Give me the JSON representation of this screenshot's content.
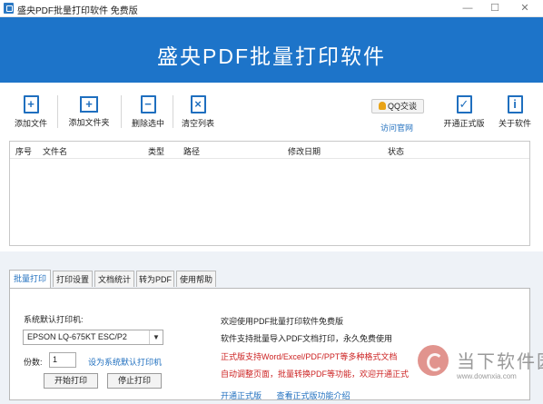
{
  "window": {
    "title": "盛央PDF批量打印软件 免费版",
    "controls": {
      "minimize": "—",
      "maximize": "☐",
      "close": "✕"
    }
  },
  "banner": {
    "title": "盛央PDF批量打印软件"
  },
  "toolbar": {
    "add_file": "添加文件",
    "add_folder": "添加文件夹",
    "delete_selected": "删除选中",
    "clear_list": "清空列表",
    "qq_button": "QQ交谈",
    "visit_site": "访问官网",
    "activate_pro": "开通正式版",
    "about": "关于软件"
  },
  "file_list": {
    "columns": [
      "序号",
      "文件名",
      "类型",
      "路径",
      "修改日期",
      "状态"
    ],
    "rows": []
  },
  "tabs": [
    {
      "label": "批量打印",
      "active": true
    },
    {
      "label": "打印设置",
      "active": false
    },
    {
      "label": "文档统计",
      "active": false
    },
    {
      "label": "转为PDF",
      "active": false
    },
    {
      "label": "使用帮助",
      "active": false
    }
  ],
  "print_panel": {
    "printer_label": "系统默认打印机:",
    "printer_selected": "EPSON LQ-675KT ESC/P2",
    "copies_label": "份数:",
    "copies_value": "1",
    "set_default_link": "设为系统默认打印机",
    "start_button": "开始打印",
    "stop_button": "停止打印"
  },
  "info": {
    "line1": "欢迎使用PDF批量打印软件免费版",
    "line2": "软件支持批量导入PDF文档打印，永久免费使用",
    "line3": "正式版支持Word/Excel/PDF/PPT等多种格式文档",
    "line4": "自动调整页面，批量转换PDF等功能，欢迎开通正式",
    "link_activate": "开通正式版",
    "link_features": "查看正式版功能介绍"
  },
  "watermark": {
    "name": "当下软件园",
    "url": "www.downxia.com"
  },
  "colors": {
    "banner": "#1d74c9",
    "accent": "#1f6fbf",
    "promo_red": "#cc2222"
  }
}
